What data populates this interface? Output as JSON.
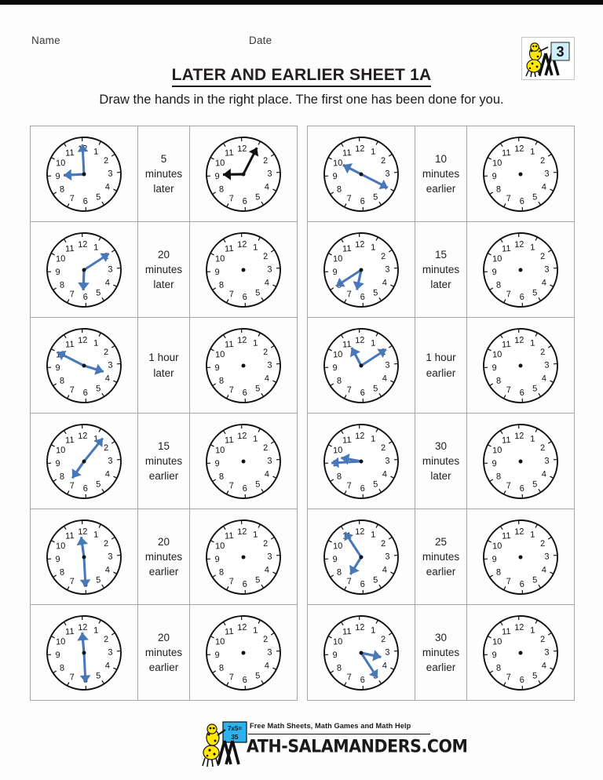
{
  "header": {
    "name_label": "Name",
    "date_label": "Date",
    "title": "LATER AND EARLIER SHEET 1A",
    "instructions": "Draw the hands in the right place. The first one has been done for you.",
    "logo_number": "3"
  },
  "clock": {
    "numerals": [
      "12",
      "1",
      "2",
      "3",
      "4",
      "5",
      "6",
      "7",
      "8",
      "9",
      "10",
      "11"
    ],
    "hand_color_answer": "#4878b8",
    "hand_color_example": "#111111"
  },
  "rows": [
    {
      "id": "r1c1",
      "left_clock": {
        "hour_angle": 270,
        "minute_angle": 0,
        "filled": true,
        "style": "answer",
        "time": "9:00"
      },
      "operation": "5\nminutes\nlater",
      "operation_lines": [
        "5",
        "minutes",
        "later"
      ],
      "right_clock": {
        "hour_angle": 272,
        "minute_angle": 30,
        "filled": true,
        "style": "example",
        "time": "9:05"
      }
    },
    {
      "id": "r1c2",
      "left_clock": {
        "hour_angle": 300,
        "minute_angle": 120,
        "filled": true,
        "style": "answer",
        "time": "10:20"
      },
      "operation_lines": [
        "10",
        "minutes",
        "earlier"
      ],
      "right_clock": {
        "filled": false
      }
    },
    {
      "id": "r2c1",
      "left_clock": {
        "hour_angle": 185,
        "minute_angle": 60,
        "filled": true,
        "style": "answer",
        "time": "6:10"
      },
      "operation_lines": [
        "20",
        "minutes",
        "later"
      ],
      "right_clock": {
        "filled": false
      }
    },
    {
      "id": "r2c2",
      "left_clock": {
        "hour_angle": 195,
        "minute_angle": 240,
        "filled": true,
        "style": "answer",
        "time": "6:40"
      },
      "operation_lines": [
        "15",
        "minutes",
        "later"
      ],
      "right_clock": {
        "filled": false
      }
    },
    {
      "id": "r3c1",
      "left_clock": {
        "hour_angle": 110,
        "minute_angle": 300,
        "filled": true,
        "style": "answer",
        "time": "3:50"
      },
      "operation_lines": [
        "1 hour",
        "later"
      ],
      "right_clock": {
        "filled": false
      }
    },
    {
      "id": "r3c2",
      "left_clock": {
        "hour_angle": 335,
        "minute_angle": 60,
        "filled": true,
        "style": "answer",
        "time": "11:10"
      },
      "operation_lines": [
        "1 hour",
        "earlier"
      ],
      "right_clock": {
        "filled": false
      }
    },
    {
      "id": "r4c1",
      "left_clock": {
        "hour_angle": 218,
        "minute_angle": 42,
        "filled": true,
        "style": "answer",
        "time": "7:07"
      },
      "operation_lines": [
        "15",
        "minutes",
        "earlier"
      ],
      "right_clock": {
        "filled": false
      }
    },
    {
      "id": "r4c2",
      "left_clock": {
        "hour_angle": 283,
        "minute_angle": 270,
        "filled": true,
        "style": "answer",
        "time": "9:45"
      },
      "operation_lines": [
        "30",
        "minutes",
        "later"
      ],
      "right_clock": {
        "filled": false
      }
    },
    {
      "id": "r5c1",
      "left_clock": {
        "hour_angle": 355,
        "minute_angle": 180,
        "filled": true,
        "style": "answer",
        "time": "12:30"
      },
      "operation_lines": [
        "20",
        "minutes",
        "earlier"
      ],
      "right_clock": {
        "filled": false
      }
    },
    {
      "id": "r5c2",
      "left_clock": {
        "hour_angle": 215,
        "minute_angle": 330,
        "filled": true,
        "style": "answer",
        "time": "7:55"
      },
      "operation_lines": [
        "25",
        "minutes",
        "earlier"
      ],
      "right_clock": {
        "filled": false
      }
    },
    {
      "id": "r6c1",
      "left_clock": {
        "hour_angle": 358,
        "minute_angle": 180,
        "filled": true,
        "style": "answer",
        "time": "12:30"
      },
      "operation_lines": [
        "20",
        "minutes",
        "earlier"
      ],
      "right_clock": {
        "filled": false
      }
    },
    {
      "id": "r6c2",
      "left_clock": {
        "hour_angle": 105,
        "minute_angle": 150,
        "filled": true,
        "style": "answer",
        "time": "3:25"
      },
      "operation_lines": [
        "30",
        "minutes",
        "earlier"
      ],
      "right_clock": {
        "filled": false
      }
    }
  ],
  "footer": {
    "tagline": "Free Math Sheets, Math Games and Math Help",
    "domain": "ATH-SALAMANDERS.COM",
    "domain_full": "MATH-SALAMANDERS.COM"
  }
}
